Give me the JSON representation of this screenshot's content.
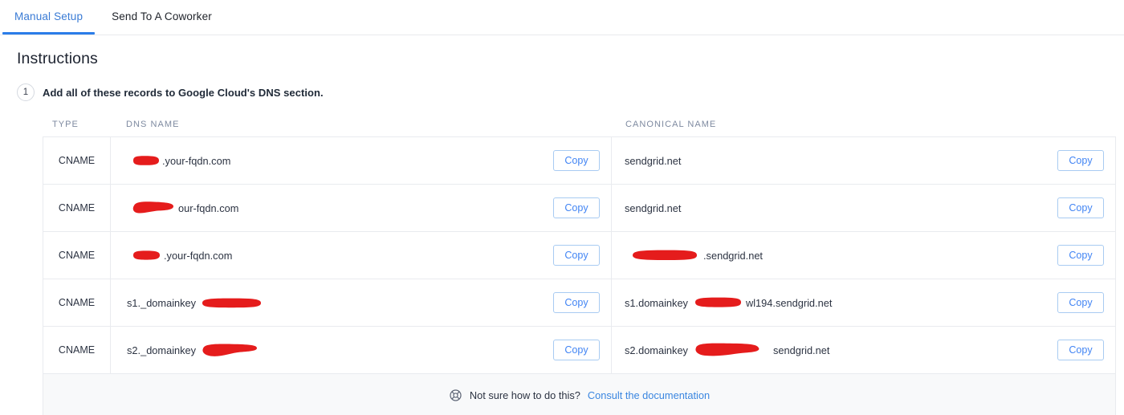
{
  "tabs": [
    {
      "label": "Manual Setup",
      "active": true
    },
    {
      "label": "Send To A Coworker",
      "active": false
    }
  ],
  "heading": "Instructions",
  "step": {
    "number": "1",
    "text": "Add all of these records to Google Cloud's DNS section."
  },
  "table": {
    "headers": {
      "type": "TYPE",
      "dns_name": "DNS NAME",
      "canonical_name": "CANONICAL NAME"
    },
    "copy_label": "Copy",
    "rows": [
      {
        "type": "CNAME",
        "dns_prefix": "",
        "dns_redacted": true,
        "dns_suffix": ".your-fqdn.com",
        "canonical_prefix": "sendgrid.net",
        "canonical_redacted": false,
        "canonical_suffix": ""
      },
      {
        "type": "CNAME",
        "dns_prefix": "",
        "dns_redacted": true,
        "dns_suffix": "our-fqdn.com",
        "canonical_prefix": "sendgrid.net",
        "canonical_redacted": false,
        "canonical_suffix": ""
      },
      {
        "type": "CNAME",
        "dns_prefix": "",
        "dns_redacted": true,
        "dns_suffix": ".your-fqdn.com",
        "canonical_prefix": "",
        "canonical_redacted": true,
        "canonical_suffix": ".sendgrid.net"
      },
      {
        "type": "CNAME",
        "dns_prefix": "s1._domainkey",
        "dns_redacted": true,
        "dns_suffix": "",
        "canonical_prefix": "s1.domainkey",
        "canonical_redacted": true,
        "canonical_suffix": "wl194.sendgrid.net"
      },
      {
        "type": "CNAME",
        "dns_prefix": "s2._domainkey",
        "dns_redacted": true,
        "dns_suffix": "",
        "canonical_prefix": "s2.domainkey",
        "canonical_redacted": true,
        "canonical_suffix": "sendgrid.net"
      }
    ]
  },
  "footer": {
    "icon": "lifebuoy-icon",
    "text": "Not sure how to do this?",
    "link": "Consult the documentation"
  },
  "colors": {
    "accent_blue": "#2b7de9",
    "link_blue": "#3a86e0",
    "copy_border": "#a8cbf2",
    "redaction_red": "#e51c1c",
    "text_primary": "#2c3342",
    "header_muted": "#7e8aa0",
    "border": "#e9ebef",
    "footer_bg": "#f8f9fa"
  }
}
